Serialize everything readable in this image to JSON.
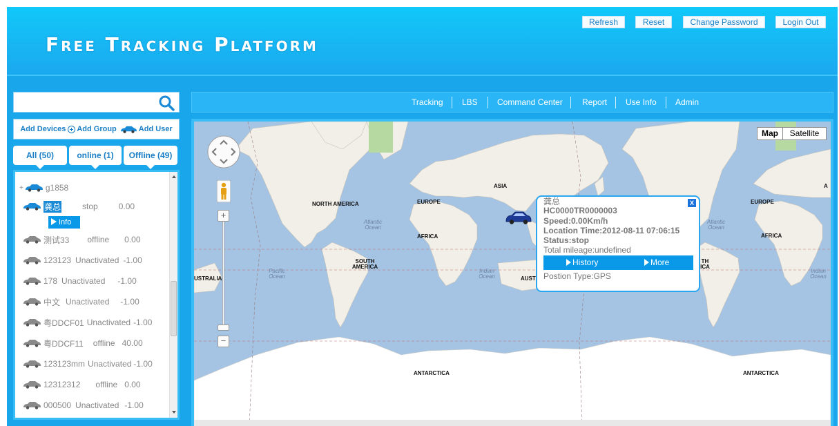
{
  "header": {
    "title": "Free Tracking Platform",
    "buttons": {
      "refresh": "Refresh",
      "reset": "Reset",
      "change_password": "Change Password",
      "login_out": "Login Out"
    }
  },
  "sidebar": {
    "search": {
      "value": "",
      "placeholder": ""
    },
    "actions": {
      "add_devices": "Add Devices",
      "add_group": "Add Group",
      "add_user": "Add User"
    },
    "filters": {
      "all": "All (50)",
      "online": "online (1)",
      "offline": "Offline (49)"
    },
    "info_button": "Info",
    "devices": [
      {
        "name": "g1858",
        "status": "",
        "value": ""
      },
      {
        "name": "龚总",
        "status": "stop",
        "value": "0.00"
      },
      {
        "name": "测试33",
        "status": "offline",
        "value": "0.00"
      },
      {
        "name": "123123",
        "status": "Unactivated",
        "value": "-1.00"
      },
      {
        "name": "178",
        "status": "Unactivated",
        "value": "-1.00"
      },
      {
        "name": "中文",
        "status": "Unactivated",
        "value": "-1.00"
      },
      {
        "name": "粤DDCF01",
        "status": "Unactivated",
        "value": "-1.00"
      },
      {
        "name": "粤DDCF11",
        "status": "offline",
        "value": "40.00"
      },
      {
        "name": "123123mm",
        "status": "Unactivated",
        "value": "-1.00"
      },
      {
        "name": "12312312",
        "status": "offline",
        "value": "0.00"
      },
      {
        "name": "000500",
        "status": "Unactivated",
        "value": "-1.00"
      }
    ]
  },
  "nav": {
    "tracking": "Tracking",
    "lbs": "LBS",
    "command_center": "Command Center",
    "report": "Report",
    "use_info": "Use Info",
    "admin": "Admin"
  },
  "map": {
    "type_map": "Map",
    "type_satellite": "Satellite",
    "zoom_in": "+",
    "zoom_out": "−",
    "labels": {
      "north_america": "NORTH AMERICA",
      "europe": "EUROPE",
      "asia": "ASIA",
      "africa": "AFRICA",
      "south_america": "SOUTH AMERICA",
      "australia": "USTRALIA",
      "aust": "AUST",
      "antarctica": "ANTARCTICA",
      "europe_2": "EUROPE",
      "africa_2": "AFRICA",
      "antarctica_2": "ANTARCTICA",
      "ica": "TH ICA",
      "a": "A"
    },
    "oceans": {
      "atlantic": "Atlantic Ocean",
      "pacific": "Pacific Ocean",
      "indian": "Indian Ocean",
      "atlantic_2": "Atlantic Ocean",
      "indian_2": "Indian Ocean"
    }
  },
  "popup": {
    "device_name": "龚总",
    "device_id": "HC0000TR0000003",
    "speed": "Speed:0.00Km/h",
    "location_time": "Location Time:2012-08-11 07:06:15",
    "status": "Status:stop",
    "total_mileage": "Total mileage:undefined",
    "history": "History",
    "more": "More",
    "position_type": "Postion Type:GPS",
    "close": "X"
  },
  "colors": {
    "header_blue": "#1aa6ea",
    "accent": "#0a98e8",
    "link": "#1a7fc6",
    "water": "#a5c3e3",
    "land": "#f2efe8"
  }
}
